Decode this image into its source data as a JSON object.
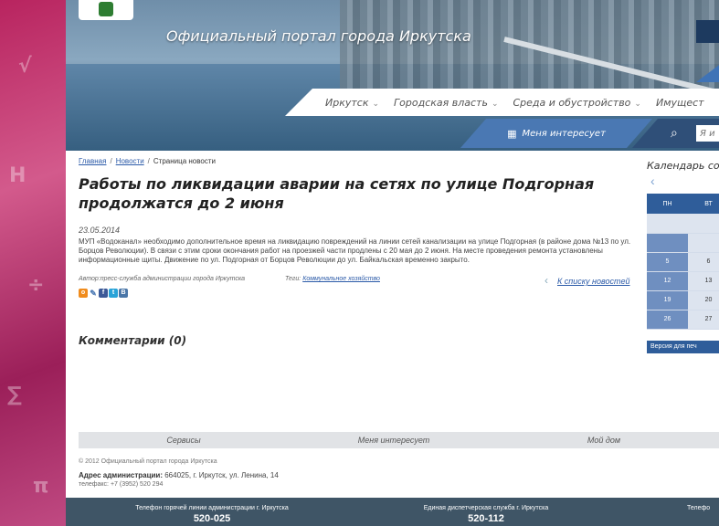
{
  "site_title": "Официальный портал города Иркутска",
  "nav": [
    {
      "label": "Иркутск"
    },
    {
      "label": "Городская власть"
    },
    {
      "label": "Среда и обустройство"
    },
    {
      "label": "Имущест"
    }
  ],
  "interest_label": "Меня интересует",
  "search_placeholder": "Я и",
  "breadcrumb": {
    "home": "Главная",
    "news": "Новости",
    "current": "Страница новости"
  },
  "article": {
    "title": "Работы по ликвидации аварии на сетях по улице Подгорная продолжатся до 2 июня",
    "date": "23.05.2014",
    "body": "МУП «Водоканал» необходимо дополнительное время на ликвидацию повреждений на линии сетей канализации на улице Подгорная (в районе дома №13 по ул. Борцов Революции). В связи с этим сроки окончания работ на проезжей части продлены с 20 мая до 2 июня. На месте проведения ремонта установлены информационные щиты. Движение по ул. Подгорная от Борцов Революции до ул. Байкальская временно закрыто.",
    "author": "Автор:пресс-служба администрации города Иркутска",
    "tags_label": "Теги:",
    "tag": "Коммунальное хозяйство",
    "back_link": "К списку новостей"
  },
  "comments_title": "Комментарии (0)",
  "calendar": {
    "title": "Календарь со",
    "headers": [
      "ПН",
      "ВТ"
    ],
    "rows": [
      [
        "",
        ""
      ],
      [
        "",
        ""
      ],
      [
        "5",
        "6"
      ],
      [
        "12",
        "13"
      ],
      [
        "19",
        "20"
      ],
      [
        "26",
        "27"
      ]
    ]
  },
  "print_label": "Версия для печ",
  "footer_tabs": [
    "Сервисы",
    "Меня интересует",
    "Мой дом"
  ],
  "copyright": "© 2012 Официальный портал города Иркутска",
  "admin_label": "Адрес администрации:",
  "admin_address": "664025, г. Иркутск, ул. Ленина, 14",
  "phone": "телефакс: +7 (3952) 520 294",
  "bottom": [
    {
      "label": "Телефон горячей линии администрации г. Иркутска",
      "number": "520-025"
    },
    {
      "label": "Единая диспетчерская служба г. Иркутска",
      "number": "520-112"
    },
    {
      "label": "Телефо",
      "number": ""
    }
  ]
}
